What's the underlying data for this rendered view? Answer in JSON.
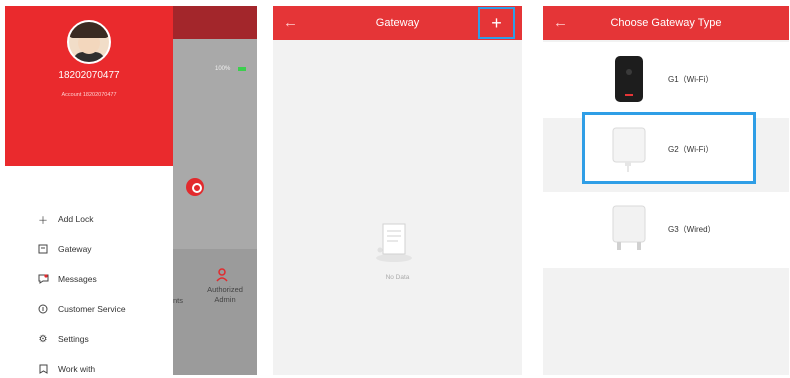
{
  "screen1": {
    "phone": "18202070477",
    "account": "Account 18202070477",
    "menu": [
      {
        "label": "Add Lock",
        "icon": "plus-icon"
      },
      {
        "label": "Gateway",
        "icon": "gateway-icon"
      },
      {
        "label": "Messages",
        "icon": "message-icon"
      },
      {
        "label": "Customer Service",
        "icon": "customer-service-icon"
      },
      {
        "label": "Settings",
        "icon": "settings-icon"
      },
      {
        "label": "Work with",
        "icon": "bookmark-icon"
      }
    ],
    "background": {
      "battery": "100%",
      "partial_label": "nts",
      "authorized_admin": "Authorized Admin"
    }
  },
  "screen2": {
    "title": "Gateway",
    "add_label": "+",
    "back_label": "←",
    "empty_text": "No Data"
  },
  "screen3": {
    "title": "Choose Gateway Type",
    "back_label": "←",
    "options": [
      {
        "label": "G1（Wi-Fi）"
      },
      {
        "label": "G2（Wi-Fi）"
      },
      {
        "label": "G3（Wired）"
      }
    ]
  },
  "colors": {
    "brand_red": "#e53537",
    "highlight_blue": "#2f9ee6"
  }
}
